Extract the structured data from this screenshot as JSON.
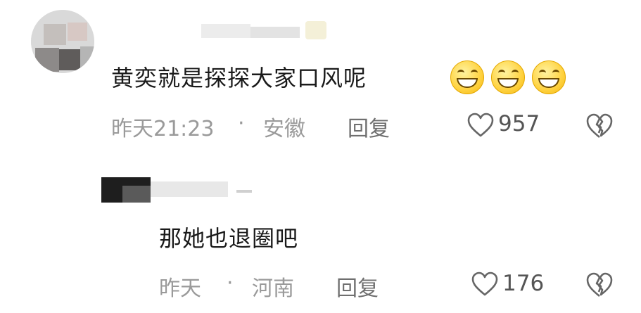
{
  "comment": {
    "text": "黄奕就是探探大家口风呢",
    "emoji_icon": "grinning-face-emoji",
    "emoji_count": 3,
    "time": "昨天21:23",
    "separator": "·",
    "location": "安徽",
    "reply_label": "回复",
    "like_count": "957"
  },
  "reply": {
    "text": "那她也退圈吧",
    "time": "昨天",
    "separator": "·",
    "location": "河南",
    "reply_label": "回复",
    "like_count": "176"
  },
  "colors": {
    "text": "#1a1a1a",
    "meta": "#9a9a9a",
    "emoji": "#ffd23f"
  }
}
